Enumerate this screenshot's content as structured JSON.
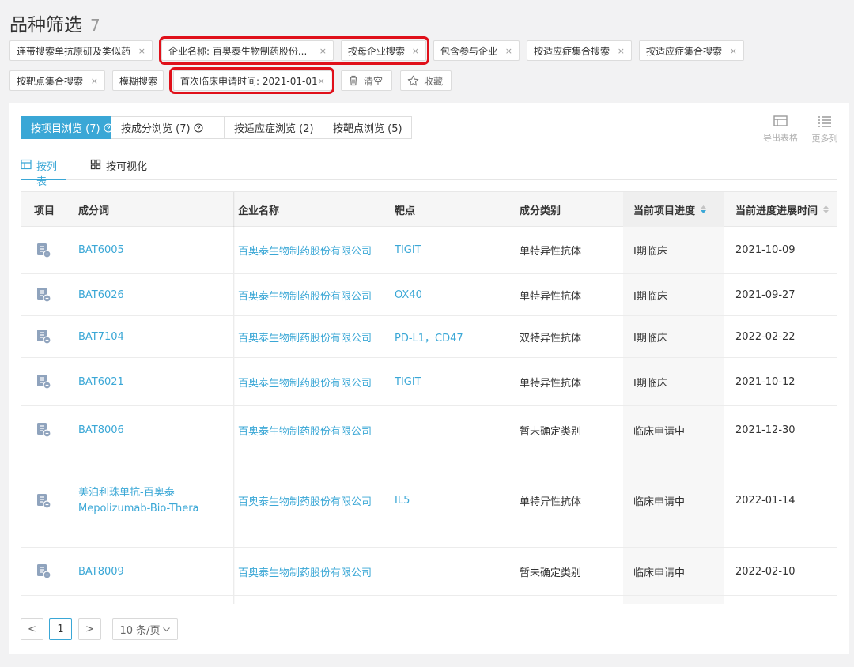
{
  "page": {
    "title": "品种筛选",
    "count": "7"
  },
  "filters": {
    "row1": [
      "连带搜索单抗原研及类似药",
      "企业名称: 百奥泰生物制药股份...",
      "按母企业搜索",
      "包含参与企业",
      "按适应症集合搜索",
      "按适应症集合搜索"
    ],
    "row2": [
      "按靶点集合搜索",
      "模糊搜索",
      "首次临床申请时间: 2021-01-01"
    ],
    "close": "×",
    "clear_label": "清空",
    "fav_label": "收藏"
  },
  "tabs": [
    {
      "label": "按项目浏览 (7)"
    },
    {
      "label": "按成分浏览 (7)"
    },
    {
      "label": "按适应症浏览 (2)"
    },
    {
      "label": "按靶点浏览 (5)"
    }
  ],
  "tools": {
    "export": "导出表格",
    "more": "更多列"
  },
  "views": {
    "list": "按列表",
    "visual": "按可视化"
  },
  "columns": {
    "project": "项目",
    "ingredient": "成分词",
    "company": "企业名称",
    "target": "靶点",
    "category": "成分类别",
    "progress": "当前项目进度",
    "time": "当前进度进展时间"
  },
  "rows": [
    {
      "ingredient": "BAT6005",
      "company": "百奥泰生物制药股份有限公司",
      "target": "TIGIT",
      "category": "单特异性抗体",
      "progress": "I期临床",
      "time": "2021-10-09"
    },
    {
      "ingredient": "BAT6026",
      "company": "百奥泰生物制药股份有限公司",
      "target": "OX40",
      "category": "单特异性抗体",
      "progress": "I期临床",
      "time": "2021-09-27"
    },
    {
      "ingredient": "BAT7104",
      "company": "百奥泰生物制药股份有限公司",
      "target": "PD-L1，CD47",
      "category": "双特异性抗体",
      "progress": "I期临床",
      "time": "2022-02-22"
    },
    {
      "ingredient": "BAT6021",
      "company": "百奥泰生物制药股份有限公司",
      "target": "TIGIT",
      "category": "单特异性抗体",
      "progress": "I期临床",
      "time": "2021-10-12"
    },
    {
      "ingredient": "BAT8006",
      "company": "百奥泰生物制药股份有限公司",
      "target": "",
      "category": "暂未确定类别",
      "progress": "临床申请中",
      "time": "2021-12-30"
    },
    {
      "ingredient": "美泊利珠单抗-百奥泰",
      "ingredient_en": "Mepolizumab-Bio-Thera",
      "company": "百奥泰生物制药股份有限公司",
      "target": "IL5",
      "category": "单特异性抗体",
      "progress": "临床申请中",
      "time": "2022-01-14"
    },
    {
      "ingredient": "BAT8009",
      "company": "百奥泰生物制药股份有限公司",
      "target": "",
      "category": "暂未确定类别",
      "progress": "临床申请中",
      "time": "2022-02-10"
    }
  ],
  "pagination": {
    "prev": "<",
    "page": "1",
    "next": ">",
    "size": "10 条/页"
  },
  "colors": {
    "accent": "#3aa7d6",
    "highlight": "#e0101a",
    "icon": "#8fa3bd"
  }
}
